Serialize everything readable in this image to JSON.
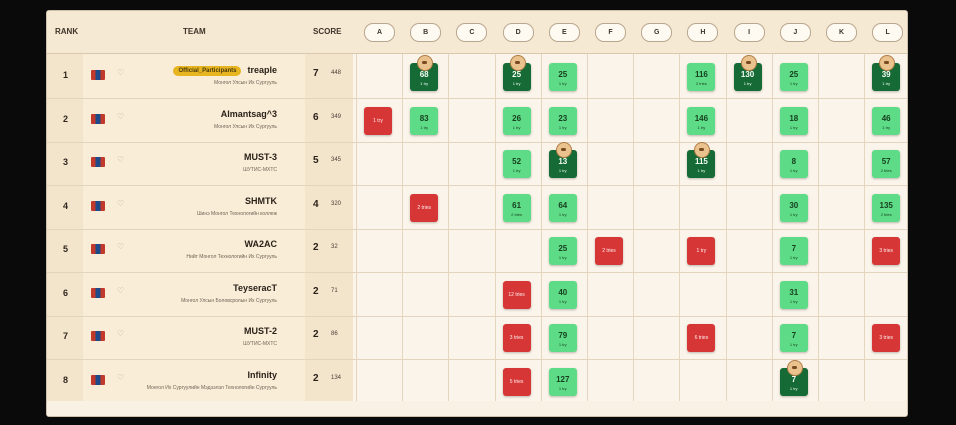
{
  "header": {
    "rank_label": "RANK",
    "team_label": "TEAM",
    "score_label": "SCORE"
  },
  "problems": [
    "A",
    "B",
    "C",
    "D",
    "E",
    "F",
    "G",
    "H",
    "I",
    "J",
    "K",
    "L"
  ],
  "colors": {
    "solved": "#5edb87",
    "first_solve": "#166a35",
    "rejected": "#d63636"
  },
  "rows": [
    {
      "rank": "1",
      "name": "treaple",
      "badge": "Official_Participants",
      "sub": "Монгол Улсын Их Сургууль",
      "solved": "7",
      "penalty": "448",
      "cells": [
        {
          "p": "B",
          "s": "first",
          "time": "68",
          "note": "1 try"
        },
        {
          "p": "D",
          "s": "first",
          "time": "25",
          "note": "1 try"
        },
        {
          "p": "E",
          "s": "ok",
          "time": "25",
          "note": "1 try"
        },
        {
          "p": "H",
          "s": "ok",
          "time": "116",
          "note": "2 tries"
        },
        {
          "p": "I",
          "s": "first",
          "time": "130",
          "note": "1 try"
        },
        {
          "p": "J",
          "s": "ok",
          "time": "25",
          "note": "1 try"
        },
        {
          "p": "L",
          "s": "first",
          "time": "39",
          "note": "1 try"
        }
      ]
    },
    {
      "rank": "2",
      "name": "Almantsag^3",
      "sub": "Монгол Улсын Их Сургууль",
      "solved": "6",
      "penalty": "349",
      "cells": [
        {
          "p": "A",
          "s": "bad",
          "time": "",
          "note": "1 try"
        },
        {
          "p": "B",
          "s": "ok",
          "time": "83",
          "note": "1 try"
        },
        {
          "p": "D",
          "s": "ok",
          "time": "26",
          "note": "1 try"
        },
        {
          "p": "E",
          "s": "ok",
          "time": "23",
          "note": "1 try"
        },
        {
          "p": "H",
          "s": "ok",
          "time": "146",
          "note": "1 try"
        },
        {
          "p": "J",
          "s": "ok",
          "time": "18",
          "note": "1 try"
        },
        {
          "p": "L",
          "s": "ok",
          "time": "46",
          "note": "1 try"
        }
      ]
    },
    {
      "rank": "3",
      "name": "MUST-3",
      "sub": "ШУТИС-МХТС",
      "solved": "5",
      "penalty": "345",
      "cells": [
        {
          "p": "D",
          "s": "ok",
          "time": "52",
          "note": "1 try"
        },
        {
          "p": "E",
          "s": "first",
          "time": "13",
          "note": "1 try"
        },
        {
          "p": "H",
          "s": "first",
          "time": "115",
          "note": "1 try"
        },
        {
          "p": "J",
          "s": "ok",
          "time": "8",
          "note": "1 try"
        },
        {
          "p": "L",
          "s": "ok",
          "time": "57",
          "note": "2 tries"
        }
      ]
    },
    {
      "rank": "4",
      "name": "SHMTK",
      "sub": "Шинэ Монгол Технологийн коллеж",
      "solved": "4",
      "penalty": "320",
      "cells": [
        {
          "p": "B",
          "s": "bad",
          "time": "",
          "note": "2 tries"
        },
        {
          "p": "D",
          "s": "ok",
          "time": "61",
          "note": "2 tries"
        },
        {
          "p": "E",
          "s": "ok",
          "time": "64",
          "note": "1 try"
        },
        {
          "p": "J",
          "s": "ok",
          "time": "30",
          "note": "1 try"
        },
        {
          "p": "L",
          "s": "ok",
          "time": "135",
          "note": "2 tries"
        }
      ]
    },
    {
      "rank": "5",
      "name": "WA2AC",
      "sub": "Нийт Монгол Технологийн Их Сургууль",
      "solved": "2",
      "penalty": "32",
      "cells": [
        {
          "p": "E",
          "s": "ok",
          "time": "25",
          "note": "1 try"
        },
        {
          "p": "F",
          "s": "bad",
          "time": "",
          "note": "2 tries"
        },
        {
          "p": "H",
          "s": "bad",
          "time": "",
          "note": "1 try"
        },
        {
          "p": "J",
          "s": "ok",
          "time": "7",
          "note": "1 try"
        },
        {
          "p": "L",
          "s": "bad",
          "time": "",
          "note": "3 tries"
        }
      ]
    },
    {
      "rank": "6",
      "name": "TeyseracT",
      "sub": "Монгол Улсын Боловсролын Их Сургууль",
      "solved": "2",
      "penalty": "71",
      "cells": [
        {
          "p": "D",
          "s": "bad",
          "time": "",
          "note": "12 tries"
        },
        {
          "p": "E",
          "s": "ok",
          "time": "40",
          "note": "1 try"
        },
        {
          "p": "J",
          "s": "ok",
          "time": "31",
          "note": "1 try"
        }
      ]
    },
    {
      "rank": "7",
      "name": "MUST-2",
      "sub": "ШУТИС-МХТС",
      "solved": "2",
      "penalty": "86",
      "cells": [
        {
          "p": "D",
          "s": "bad",
          "time": "",
          "note": "3 tries"
        },
        {
          "p": "E",
          "s": "ok",
          "time": "79",
          "note": "1 try"
        },
        {
          "p": "H",
          "s": "bad",
          "time": "",
          "note": "6 tries"
        },
        {
          "p": "J",
          "s": "ok",
          "time": "7",
          "note": "1 try"
        },
        {
          "p": "L",
          "s": "bad",
          "time": "",
          "note": "3 tries"
        }
      ]
    },
    {
      "rank": "8",
      "name": "Infinity",
      "sub": "Монгол Их Сургуулийн Мэдээлэл Технологийн Сургууль",
      "solved": "2",
      "penalty": "134",
      "cells": [
        {
          "p": "D",
          "s": "bad",
          "time": "",
          "note": "5 tries"
        },
        {
          "p": "E",
          "s": "ok",
          "time": "127",
          "note": "1 try"
        },
        {
          "p": "J",
          "s": "first",
          "time": "7",
          "note": "1 try"
        }
      ]
    }
  ]
}
